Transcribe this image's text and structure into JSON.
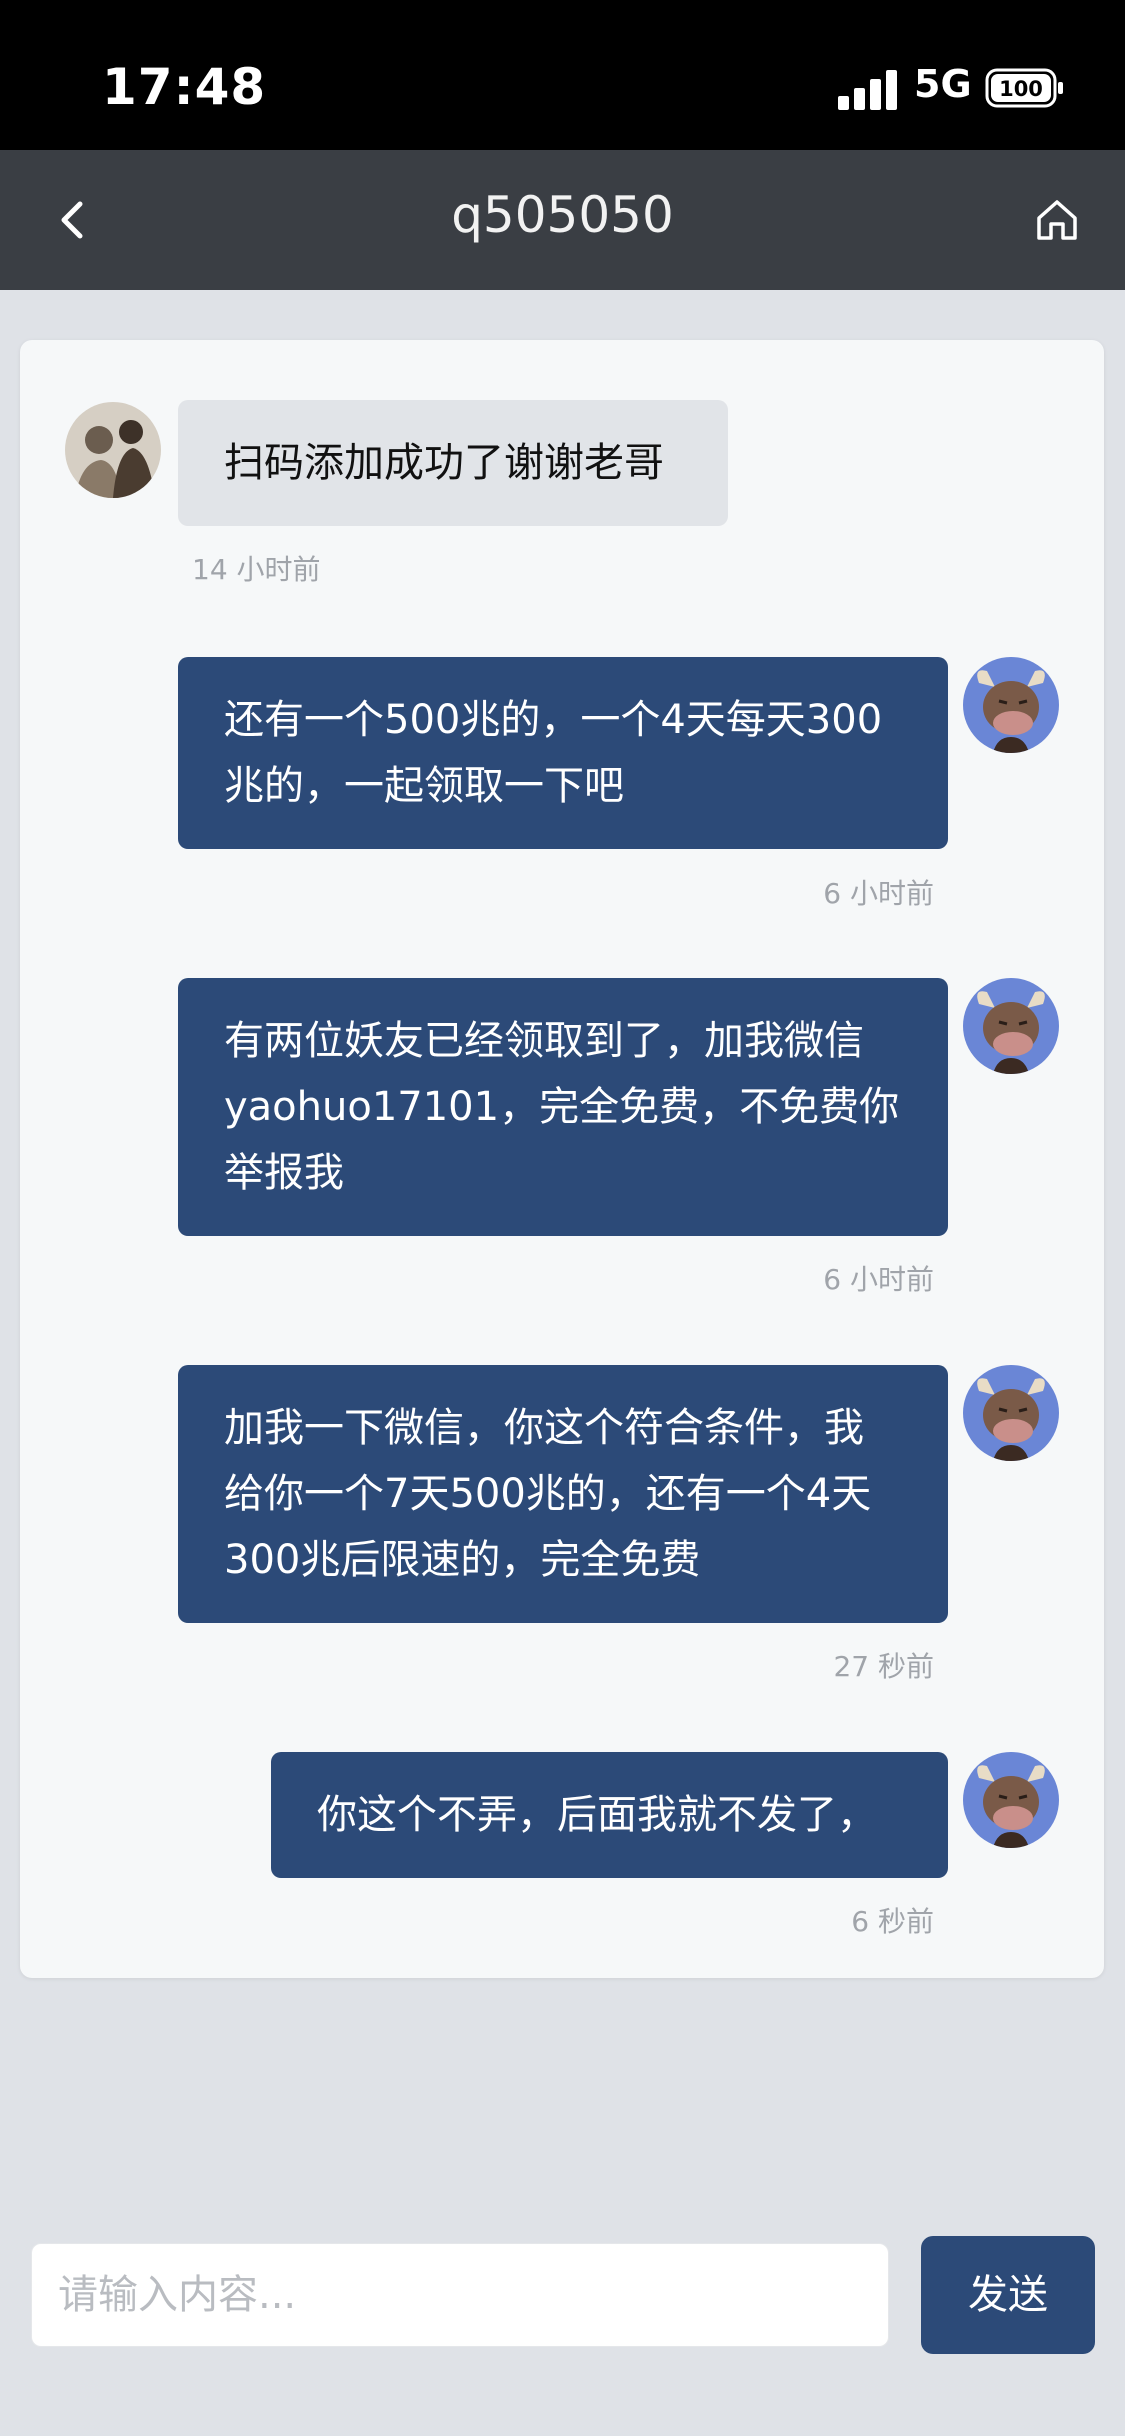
{
  "status_bar": {
    "time": "17:48",
    "network": "5G",
    "battery": "100"
  },
  "nav": {
    "back_icon": "chevron-left-icon",
    "title": "q505050",
    "home_icon": "home-icon"
  },
  "messages": [
    {
      "direction": "in",
      "text": "扫码添加成功了谢谢老哥",
      "time": "14 小时前"
    },
    {
      "direction": "out",
      "text": "还有一个500兆的，一个4天每天300兆的，一起领取一下吧",
      "time": "6 小时前"
    },
    {
      "direction": "out",
      "text": "有两位妖友已经领取到了，加我微信yaohuo17101，完全免费，不免费你举报我",
      "time": "6 小时前"
    },
    {
      "direction": "out",
      "text": "加我一下微信，你这个符合条件，我给你一个7天500兆的，还有一个4天300兆后限速的，完全免费",
      "time": "27 秒前"
    },
    {
      "direction": "out",
      "text": "你这个不弄，后面我就不发了，",
      "time": "6 秒前"
    }
  ],
  "composer": {
    "placeholder": "请输入内容...",
    "send_label": "发送"
  },
  "colors": {
    "outgoing_bubble": "#2c4a78",
    "incoming_bubble": "#e1e4e8",
    "nav_bg": "#3a3e44"
  }
}
